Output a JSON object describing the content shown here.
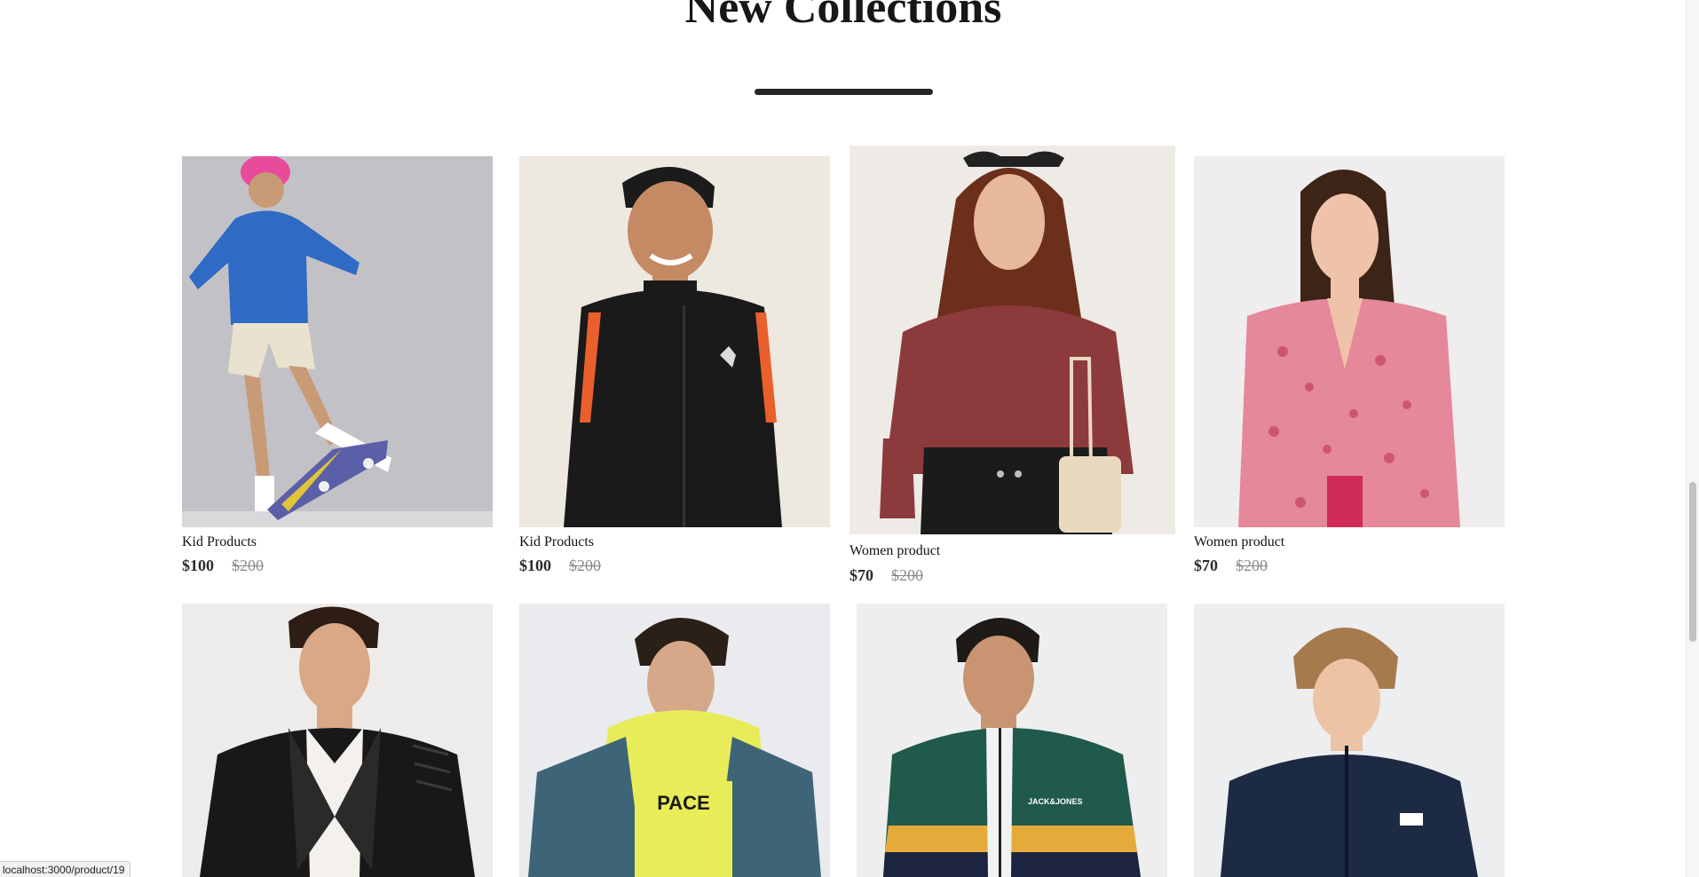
{
  "section": {
    "title": "New Collections"
  },
  "products": [
    {
      "name": "Kid Products",
      "new_price": "$100",
      "old_price": "$200"
    },
    {
      "name": "Kid Products",
      "new_price": "$100",
      "old_price": "$200"
    },
    {
      "name": "Women product",
      "new_price": "$70",
      "old_price": "$200"
    },
    {
      "name": "Women product",
      "new_price": "$70",
      "old_price": "$200"
    },
    {
      "name": "",
      "new_price": "",
      "old_price": ""
    },
    {
      "name": "",
      "new_price": "",
      "old_price": ""
    },
    {
      "name": "",
      "new_price": "",
      "old_price": ""
    },
    {
      "name": "",
      "new_price": "",
      "old_price": ""
    }
  ],
  "status_bar": {
    "url": "localhost:3000/product/19"
  },
  "colors": {
    "heading": "#171717",
    "underline": "#252525",
    "price_new": "#2c2c2c",
    "price_old": "#8a8a8a"
  }
}
